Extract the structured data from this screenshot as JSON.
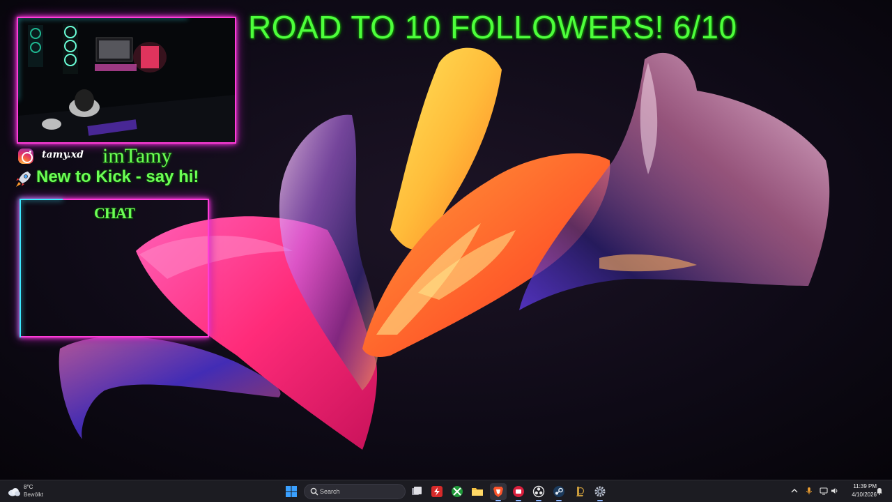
{
  "overlay": {
    "goal_text": "ROAD TO 10 FOLLOWERS! 6/10",
    "instagram_handle": "tamy.xd",
    "streamer_name": "imTamy",
    "tagline": "New to Kick - say hi!",
    "chat_title": "CHAT",
    "followers_current": 6,
    "followers_goal": 10
  },
  "taskbar": {
    "weather": {
      "temp": "8°C",
      "condition": "Bewölkt",
      "icon": "cloud-icon"
    },
    "search": {
      "placeholder": "Search"
    },
    "pinned_apps": [
      {
        "name": "start-button",
        "icon": "windows-icon"
      },
      {
        "name": "task-view",
        "icon": "task-view-icon"
      },
      {
        "name": "flash-app",
        "icon": "flash-icon"
      },
      {
        "name": "xbox-app",
        "icon": "xbox-icon"
      },
      {
        "name": "file-explorer",
        "icon": "folder-icon"
      },
      {
        "name": "brave-browser",
        "icon": "brave-icon"
      },
      {
        "name": "red-app",
        "icon": "app-icon"
      },
      {
        "name": "obs-studio",
        "icon": "obs-icon"
      },
      {
        "name": "steam",
        "icon": "steam-icon"
      },
      {
        "name": "league-client",
        "icon": "league-icon"
      },
      {
        "name": "settings",
        "icon": "gear-icon"
      }
    ],
    "tray": {
      "chevron": "chevron-up-icon",
      "mic": "microphone-icon",
      "network": "network-icon",
      "volume": "volume-icon",
      "battery": "battery-icon",
      "notification": "bell-icon"
    },
    "clock": {
      "time": "11:39 PM",
      "date": "4/10/2026"
    }
  },
  "colors": {
    "neon_green": "#4dff3b",
    "neon_pink": "#ff3cd9",
    "neon_cyan": "#3ce8ff",
    "taskbar_bg": "#1c1c22"
  }
}
